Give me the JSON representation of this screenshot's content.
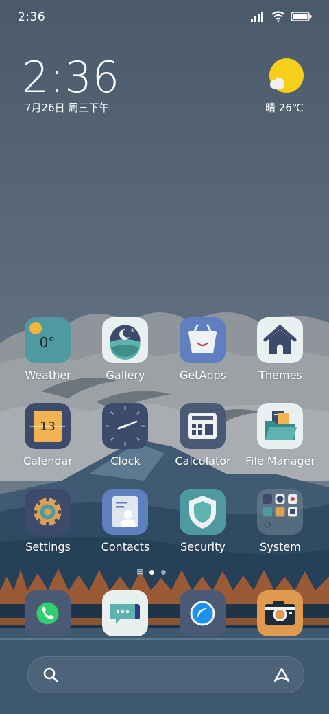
{
  "status_bar": {
    "time": "2:36"
  },
  "clock_widget": {
    "time": "2:36",
    "date": "7月26日 周三下午"
  },
  "weather_widget": {
    "text": "晴 26℃"
  },
  "weather_app_temp": "0°",
  "calendar_app_day": "13",
  "apps": {
    "weather": "Weather",
    "gallery": "Gallery",
    "getapps": "GetApps",
    "themes": "Themes",
    "calendar": "Calendar",
    "clock": "Clock",
    "calculator": "Calculator",
    "file_manager": "File Manager",
    "settings": "Settings",
    "contacts": "Contacts",
    "security": "Security",
    "system": "System"
  },
  "dock": [
    "phone-icon",
    "messages-icon",
    "browser-icon",
    "camera-icon"
  ],
  "page_indicator": {
    "pages": 2,
    "current": 1
  },
  "colors": {
    "sun": "#f6cf1a",
    "tile_light": "#eaf1f2",
    "tile_dark": "#3c4a6b"
  }
}
